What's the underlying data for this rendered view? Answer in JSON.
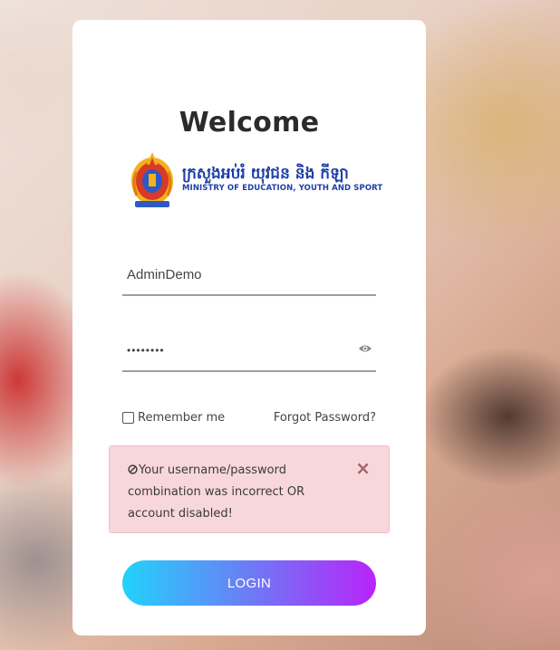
{
  "login": {
    "title": "Welcome",
    "logo": {
      "khmer_text": "ក្រសួងអប់រំ យុវជន និង កីឡា",
      "english_text": "MINISTRY OF EDUCATION, YOUTH AND SPORT"
    },
    "username": {
      "value": "AdminDemo",
      "placeholder": ""
    },
    "password": {
      "value": "AdminDem",
      "show_icon": "eye-icon"
    },
    "remember_label": "Remember me",
    "forgot_label": "Forgot Password?",
    "alert": {
      "icon": "ban-icon",
      "message": "Your username/password combination was incorrect OR account disabled!",
      "close_glyph": "×"
    },
    "login_label": "LOGIN"
  },
  "colors": {
    "alert_bg": "#f8d7da",
    "button_gradient_start": "#22d3fb",
    "button_gradient_end": "#b824fa",
    "logo_text": "#1f3fa6",
    "title": "#2b2b2b"
  }
}
